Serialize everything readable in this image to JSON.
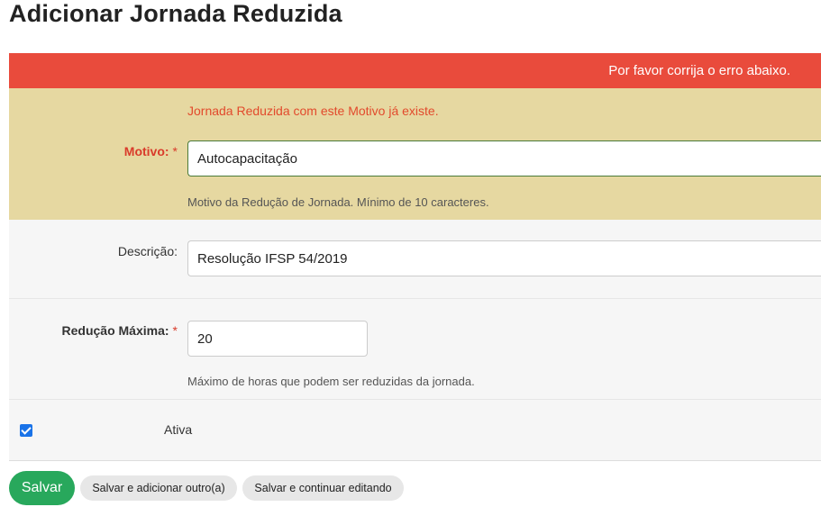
{
  "page": {
    "title": "Adicionar Jornada Reduzida"
  },
  "error_banner": {
    "text": "Por favor corrija o erro abaixo."
  },
  "form": {
    "motivo": {
      "label": "Motivo:",
      "required_mark": "*",
      "error": "Jornada Reduzida com este Motivo já existe.",
      "value": "Autocapacitação",
      "help": "Motivo da Redução de Jornada. Mínimo de 10 caracteres."
    },
    "descricao": {
      "label": "Descrição:",
      "value": "Resolução IFSP 54/2019"
    },
    "reducao_maxima": {
      "label": "Redução Máxima:",
      "required_mark": "*",
      "value": "20",
      "help": "Máximo de horas que podem ser reduzidas da jornada."
    },
    "ativa": {
      "label": "Ativa",
      "checked": true
    }
  },
  "actions": {
    "save": "Salvar",
    "save_add": "Salvar e adicionar outro(a)",
    "save_continue": "Salvar e continuar editando"
  },
  "colors": {
    "error_banner": "#e94b3c",
    "error_row": "#e6d8a1",
    "primary_button": "#28a85c",
    "checkbox": "#1a73e8"
  }
}
